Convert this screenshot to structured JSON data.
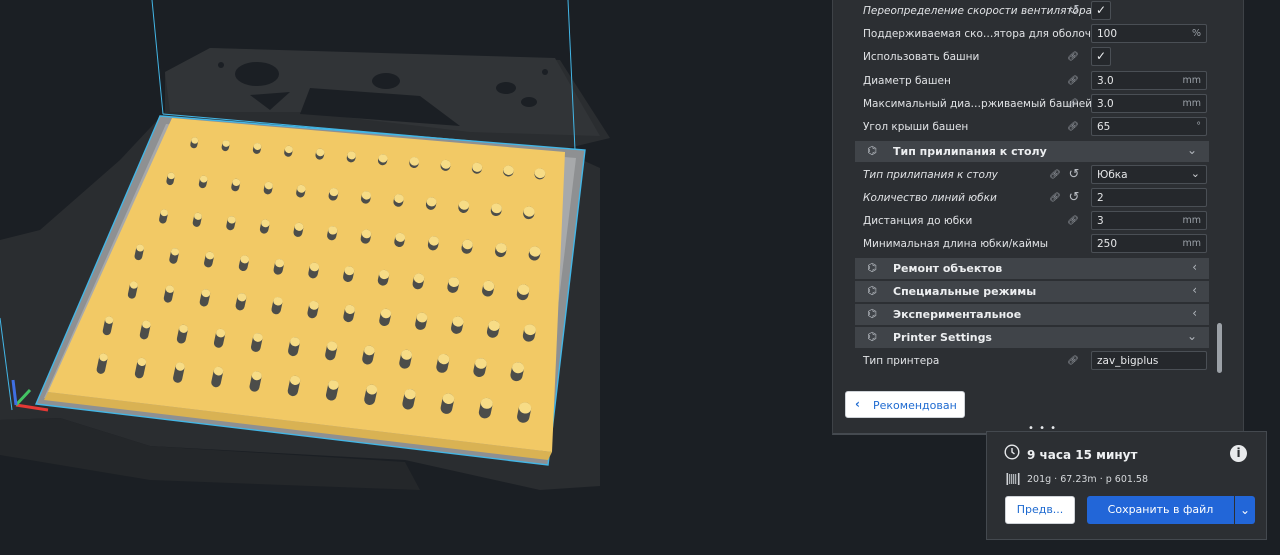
{
  "settings": {
    "rows": [
      {
        "label": "Переопределение скорости вентилятора",
        "italic": true,
        "link": false,
        "reset": true,
        "type": "check",
        "value": ""
      },
      {
        "label": "Поддерживаемая ско…ятора для оболочки",
        "italic": false,
        "link": false,
        "reset": false,
        "type": "input",
        "value": "100",
        "unit": "%"
      },
      {
        "label": "Использовать башни",
        "italic": false,
        "link": true,
        "reset": false,
        "type": "check",
        "value": ""
      },
      {
        "label": "Диаметр башен",
        "italic": false,
        "link": true,
        "reset": false,
        "type": "input",
        "value": "3.0",
        "unit": "mm"
      },
      {
        "label": "Максимальный диа…рживаемый башней",
        "italic": false,
        "link": true,
        "reset": false,
        "type": "input",
        "value": "3.0",
        "unit": "mm"
      },
      {
        "label": "Угол крыши башен",
        "italic": false,
        "link": true,
        "reset": false,
        "type": "input",
        "value": "65",
        "unit": "°"
      }
    ],
    "adhesion_category": {
      "label": "Тип прилипания к столу",
      "icon": "adhesion-icon",
      "expanded": true
    },
    "adhesion_rows": [
      {
        "label": "Тип прилипания к столу",
        "italic": true,
        "link": true,
        "reset": true,
        "type": "select",
        "value": "Юбка"
      },
      {
        "label": "Количество линий юбки",
        "italic": true,
        "link": true,
        "reset": true,
        "type": "input",
        "value": "2",
        "unit": ""
      },
      {
        "label": "Дистанция до юбки",
        "italic": false,
        "link": true,
        "reset": false,
        "type": "input",
        "value": "3",
        "unit": "mm"
      },
      {
        "label": "Минимальная длина юбки/каймы",
        "italic": false,
        "link": false,
        "reset": false,
        "type": "input",
        "value": "250",
        "unit": "mm"
      }
    ],
    "categories": [
      {
        "label": "Ремонт объектов",
        "icon": "mesh-fix-icon",
        "expanded": false
      },
      {
        "label": "Специальные режимы",
        "icon": "special-modes-icon",
        "expanded": false
      },
      {
        "label": "Экспериментальное",
        "icon": "experimental-flask-icon",
        "expanded": false
      },
      {
        "label": "Printer Settings",
        "icon": "printer-settings-icon",
        "expanded": true
      }
    ],
    "printer_rows": [
      {
        "label": "Тип принтера",
        "italic": false,
        "link": true,
        "reset": false,
        "type": "input",
        "value": "zav_bigplus",
        "unit": ""
      }
    ],
    "recommended_label": "Рекомендован",
    "handle": "• • •"
  },
  "print_summary": {
    "time": "9 часа 15 минут",
    "material": "201g · 67.23m · р 601.58",
    "preview_label": "Предв...",
    "save_label": "Сохранить в файл"
  },
  "colors": {
    "accent": "#2266d8",
    "model": "#f2c965",
    "build_plate": "#2b2e31",
    "panel": "#2c2f33"
  }
}
